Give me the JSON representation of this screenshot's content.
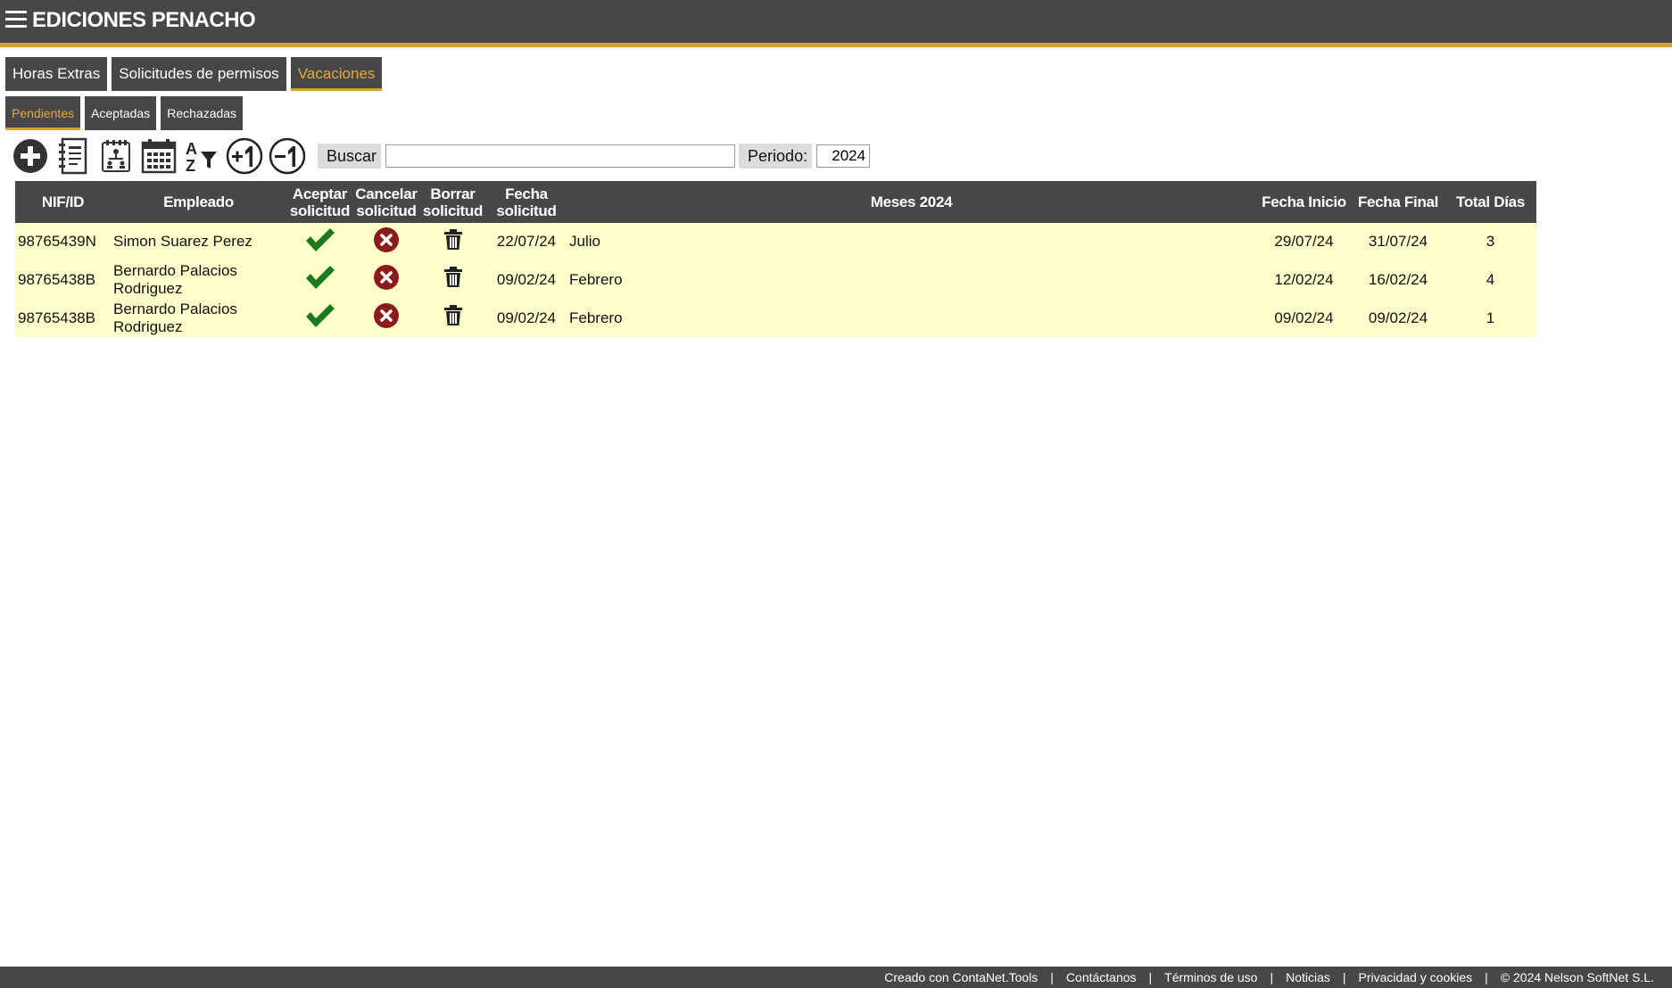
{
  "header": {
    "brand": "EDICIONES PENACHO"
  },
  "tabs": [
    "Horas Extras",
    "Solicitudes de permisos",
    "Vacaciones"
  ],
  "subtabs": [
    "Pendientes",
    "Aceptadas",
    "Rechazadas"
  ],
  "toolbar": {
    "search_label": "Buscar",
    "search_value": "",
    "period_label": "Periodo:",
    "period_value": "2024"
  },
  "table": {
    "headers": {
      "nif": "NIF/ID",
      "empleado": "Empleado",
      "aceptar_1": "Aceptar",
      "aceptar_2": "solicitud",
      "cancelar_1": "Cancelar",
      "cancelar_2": "solicitud",
      "borrar_1": "Borrar",
      "borrar_2": "solicitud",
      "fecha_1": "Fecha",
      "fecha_2": "solicitud",
      "meses": "Meses 2024",
      "inicio": "Fecha Inicio",
      "final": "Fecha Final",
      "total": "Total Días"
    },
    "rows": [
      {
        "nif": "98765439N",
        "empleado": "Simon Suarez Perez",
        "fecha_solicitud": "22/07/24",
        "mes": "Julio",
        "inicio": "29/07/24",
        "final": "31/07/24",
        "total": "3"
      },
      {
        "nif": "98765438B",
        "empleado": "Bernardo Palacios Rodriguez",
        "fecha_solicitud": "09/02/24",
        "mes": "Febrero",
        "inicio": "12/02/24",
        "final": "16/02/24",
        "total": "4"
      },
      {
        "nif": "98765438B",
        "empleado": "Bernardo Palacios Rodriguez",
        "fecha_solicitud": "09/02/24",
        "mes": "Febrero",
        "inicio": "09/02/24",
        "final": "09/02/24",
        "total": "1"
      }
    ]
  },
  "footer": {
    "links": [
      "Creado con ContaNet.Tools",
      "Contáctanos",
      "Términos de uso",
      "Noticias",
      "Privacidad y cookies"
    ],
    "copyright": "© 2024 Nelson SoftNet S.L.",
    "separator": "|"
  },
  "colors": {
    "header_bg": "#474747",
    "accent": "#d6a32c",
    "active_tab_text": "#e8a83a",
    "row_bg": "#ffffcc",
    "accept": "#1c7a1c",
    "cancel": "#8b1a1a"
  },
  "icons": [
    "menu-icon",
    "add-icon",
    "contact-book-icon",
    "org-chart-icon",
    "calendar-icon",
    "sort-filter-icon",
    "plus-one-icon",
    "minus-one-icon",
    "check-icon",
    "cancel-icon",
    "trash-icon"
  ]
}
